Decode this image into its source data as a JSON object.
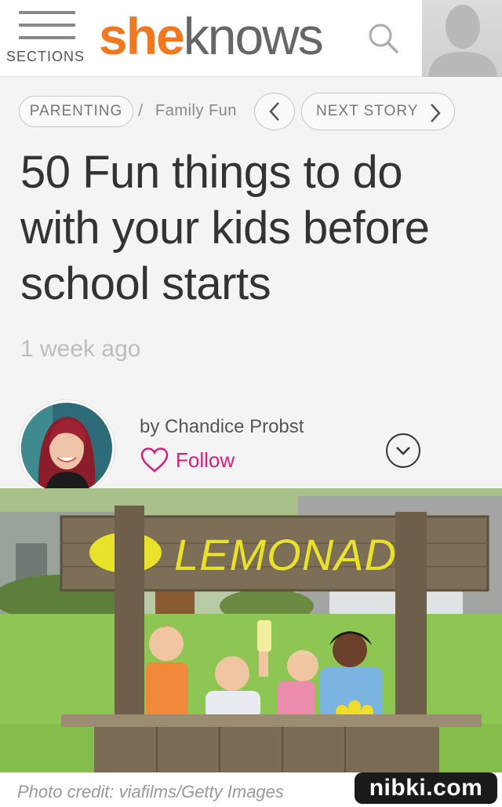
{
  "header": {
    "sections_label": "SECTIONS",
    "logo_she": "she",
    "logo_knows": "knows",
    "search_icon": "search-icon",
    "account_icon": "user-silhouette-icon",
    "brand_orange": "#f07820"
  },
  "breadcrumb": {
    "category": "PARENTING",
    "separator": "/",
    "subcategory": "Family Fun",
    "prev_icon": "chevron-left-icon",
    "next_label": "NEXT STORY",
    "next_icon": "chevron-right-icon"
  },
  "article": {
    "title": "50 Fun things to do with your kids before school starts",
    "date": "1 week ago",
    "author_byline": "by Chandice Probst",
    "follow_label": "Follow",
    "follow_icon": "heart-outline-icon",
    "follow_color": "#d4207a",
    "expand_icon": "chevron-down-circle-icon"
  },
  "hero": {
    "sign_text": "LEMONADE",
    "photo_credit": "Photo credit: viafilms/Getty Images"
  },
  "watermark": "nibki.com"
}
